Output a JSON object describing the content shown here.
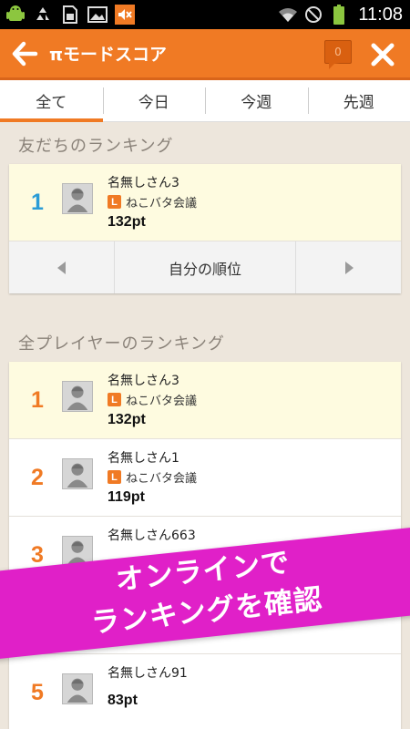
{
  "status_bar": {
    "time": "11:08"
  },
  "header": {
    "title": "πモードスコア",
    "notification_count": "0"
  },
  "tabs": [
    {
      "label": "全て",
      "active": true
    },
    {
      "label": "今日",
      "active": false
    },
    {
      "label": "今週",
      "active": false
    },
    {
      "label": "先週",
      "active": false
    }
  ],
  "friends_section": {
    "title": "友だちのランキング",
    "rows": [
      {
        "rank": "1",
        "name": "名無しさん3",
        "club": "ねこバタ会議",
        "points": "132pt"
      }
    ],
    "pager": {
      "middle_label": "自分の順位"
    }
  },
  "all_section": {
    "title": "全プレイヤーのランキング",
    "rows": [
      {
        "rank": "1",
        "name": "名無しさん3",
        "club": "ねこバタ会議",
        "points": "132pt"
      },
      {
        "rank": "2",
        "name": "名無しさん1",
        "club": "ねこバタ会議",
        "points": "119pt"
      },
      {
        "rank": "3",
        "name": "名無しさん663"
      },
      {
        "rank": "5",
        "name": "名無しさん91",
        "points": "83pt"
      }
    ]
  },
  "banner": {
    "line1": "オンラインで",
    "line2": "ランキングを確認"
  }
}
